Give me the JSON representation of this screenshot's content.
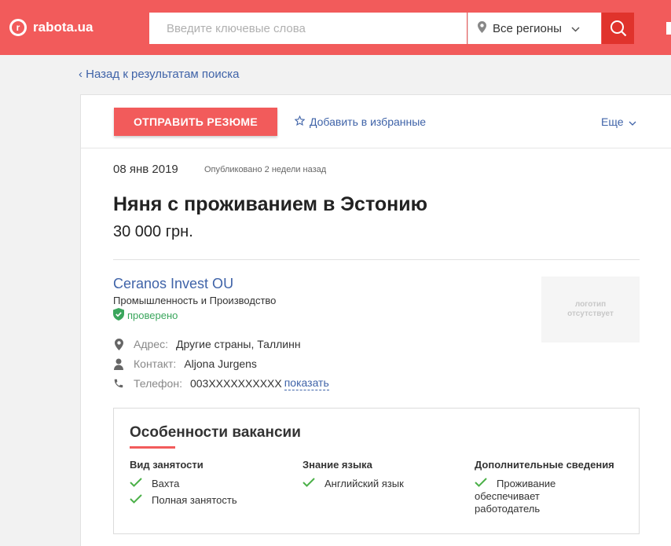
{
  "header": {
    "logo_text": "rabota.ua",
    "search_placeholder": "Введите ключевые слова",
    "region": "Все регионы",
    "brand_color": "#f25b5b"
  },
  "nav": {
    "back_label": "Назад к результатам поиска"
  },
  "toolbar": {
    "send_label": "ОТПРАВИТЬ РЕЗЮМЕ",
    "favorite_label": "Добавить в избранные",
    "more_label": "Еще"
  },
  "vacancy": {
    "date": "08 янв 2019",
    "published": "Опубликовано 2 недели назад",
    "title": "Няня с проживанием в Эстонию",
    "salary": "30 000 грн."
  },
  "company": {
    "name": "Ceranos Invest OU",
    "industry": "Промышленность и Производство",
    "verified_label": "проверено",
    "logo_placeholder_line1": "логотип",
    "logo_placeholder_line2": "отсутствует"
  },
  "contacts": {
    "address_label": "Адрес:",
    "address_value": "Другие страны, Таллинн",
    "contact_label": "Контакт:",
    "contact_value": "Aljona Jurgens",
    "phone_label": "Телефон:",
    "phone_value": "003XXXXXXXXXX",
    "show_label": "показать"
  },
  "features": {
    "title": "Особенности вакансии",
    "columns": [
      {
        "heading": "Вид занятости",
        "items": [
          "Вахта",
          "Полная занятость"
        ]
      },
      {
        "heading": "Знание языка",
        "items": [
          "Английский язык"
        ]
      },
      {
        "heading": "Дополнительные сведения",
        "items": [
          "Проживание обеспечивает работодатель"
        ]
      }
    ]
  }
}
